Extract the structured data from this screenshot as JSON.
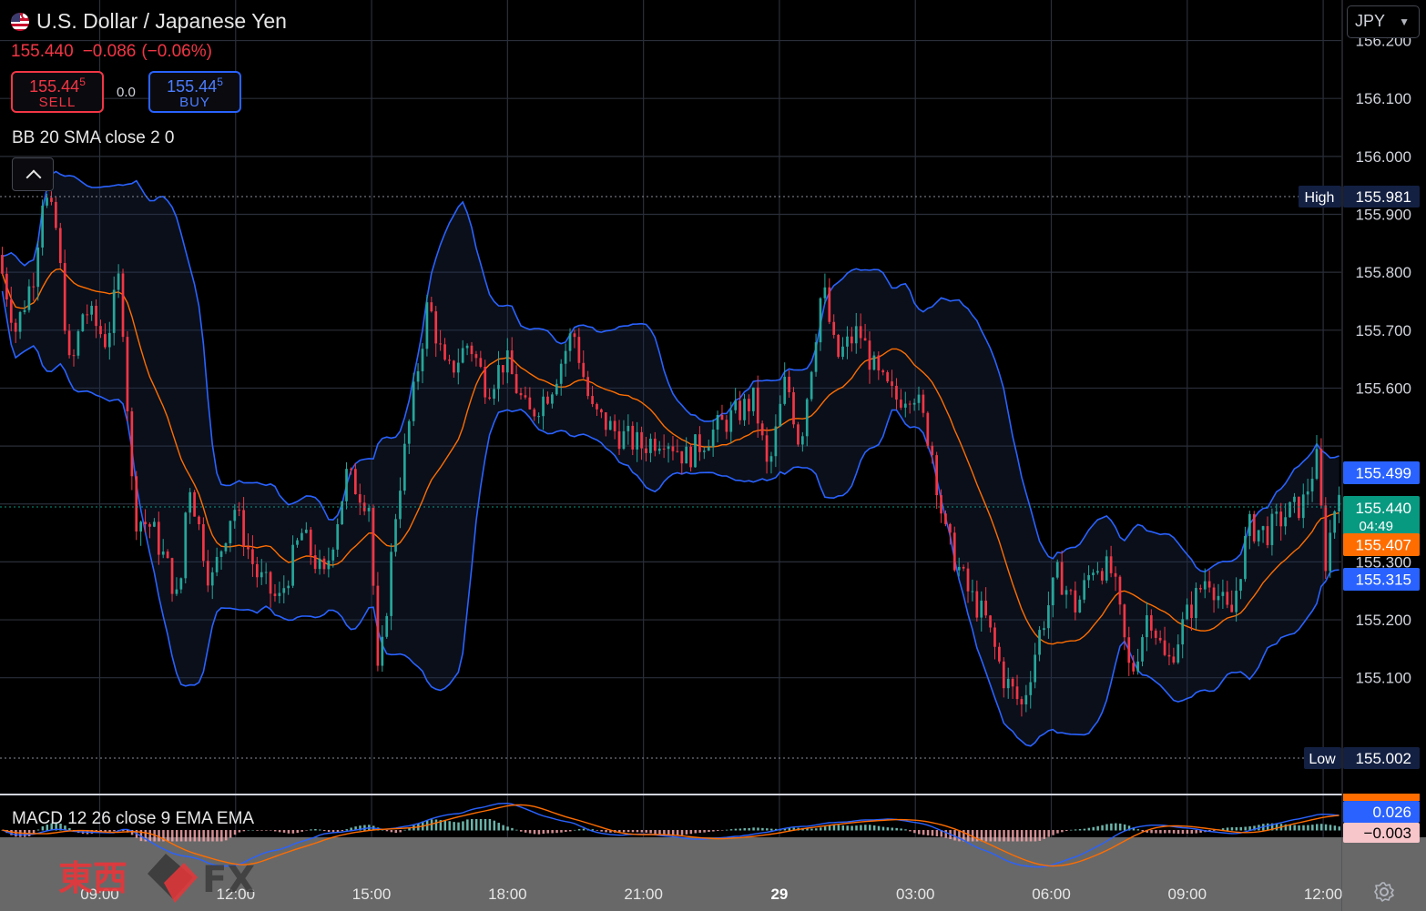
{
  "header": {
    "title": "U.S. Dollar / Japanese Yen",
    "last": "155.440",
    "change": "−0.086",
    "change_pct": "(−0.06%)",
    "sell": {
      "price_main": "155.44",
      "price_sup": "5",
      "label": "SELL"
    },
    "buy": {
      "price_main": "155.44",
      "price_sup": "5",
      "label": "BUY"
    },
    "spread": "0.0",
    "indicator_label": "BB 20 SMA close 2 0",
    "macd_label": "MACD 12 26 close 9 EMA EMA",
    "currency": "JPY"
  },
  "colors": {
    "up": "#26a69a",
    "down": "#f23645",
    "bb": "#2962ff",
    "basis": "#ff6d00",
    "grid": "#2a2e39",
    "text": "#d1d4dc",
    "bg": "#000000",
    "last": "#089981"
  },
  "icons": [
    "us-flag-icon",
    "chevron-down-icon",
    "chevron-up-icon",
    "gear-icon"
  ],
  "chart_data": {
    "type": "candlestick",
    "price_axis": {
      "min": 154.9,
      "max": 156.27,
      "ticks": [
        156.2,
        156.1,
        156.0,
        155.9,
        155.8,
        155.7,
        155.6,
        155.5,
        155.4,
        155.3,
        155.2,
        155.1
      ],
      "tick_labels": [
        "156.200",
        "156.100",
        "156.000",
        "155.900",
        "155.800",
        "155.700",
        "155.600",
        "",
        "",
        "155.300",
        "155.200",
        "155.100"
      ]
    },
    "time_axis": {
      "labels": [
        "09:00",
        "12:00",
        "15:00",
        "18:00",
        "21:00",
        "29",
        "03:00",
        "06:00",
        "09:00",
        "12:00"
      ],
      "label_hours": [
        0,
        3,
        6,
        9,
        12,
        15,
        18,
        21,
        24,
        27
      ],
      "start_hour": -2.2,
      "end_hour": 27.4
    },
    "markers": {
      "high": {
        "label": "High",
        "value": "155.981"
      },
      "low": {
        "label": "Low",
        "value": "155.002"
      },
      "bb_upper": {
        "value": "155.499"
      },
      "last": {
        "value": "155.440",
        "countdown": "04:49"
      },
      "basis": {
        "value": "155.407"
      },
      "bb_lower": {
        "value": "155.315"
      }
    },
    "close_path": [
      [
        -2.2,
        155.83
      ],
      [
        -1.8,
        155.7
      ],
      [
        -1.4,
        155.8
      ],
      [
        -1.2,
        155.94
      ],
      [
        -0.9,
        155.87
      ],
      [
        -0.6,
        155.62
      ],
      [
        -0.3,
        155.74
      ],
      [
        0.2,
        155.68
      ],
      [
        0.5,
        155.8
      ],
      [
        0.8,
        155.38
      ],
      [
        1.2,
        155.36
      ],
      [
        1.6,
        155.28
      ],
      [
        1.8,
        155.22
      ],
      [
        2.0,
        155.45
      ],
      [
        2.5,
        155.26
      ],
      [
        3.0,
        155.4
      ],
      [
        3.5,
        155.28
      ],
      [
        4.0,
        155.23
      ],
      [
        4.5,
        155.35
      ],
      [
        5.0,
        155.27
      ],
      [
        5.5,
        155.45
      ],
      [
        6.0,
        155.4
      ],
      [
        6.2,
        155.08
      ],
      [
        6.6,
        155.4
      ],
      [
        7.0,
        155.6
      ],
      [
        7.3,
        155.75
      ],
      [
        7.7,
        155.62
      ],
      [
        8.2,
        155.68
      ],
      [
        8.6,
        155.6
      ],
      [
        9.0,
        155.65
      ],
      [
        9.5,
        155.55
      ],
      [
        10.0,
        155.6
      ],
      [
        10.5,
        155.7
      ],
      [
        10.9,
        155.56
      ],
      [
        11.5,
        155.52
      ],
      [
        12.0,
        155.5
      ],
      [
        12.5,
        155.52
      ],
      [
        13.0,
        155.48
      ],
      [
        13.5,
        155.52
      ],
      [
        14.0,
        155.55
      ],
      [
        14.5,
        155.58
      ],
      [
        14.8,
        155.45
      ],
      [
        15.2,
        155.62
      ],
      [
        15.5,
        155.5
      ],
      [
        16.0,
        155.78
      ],
      [
        16.3,
        155.65
      ],
      [
        16.8,
        155.7
      ],
      [
        17.2,
        155.62
      ],
      [
        17.6,
        155.58
      ],
      [
        18.0,
        155.6
      ],
      [
        18.4,
        155.5
      ],
      [
        18.7,
        155.35
      ],
      [
        19.2,
        155.25
      ],
      [
        19.6,
        155.2
      ],
      [
        20.0,
        155.1
      ],
      [
        20.4,
        155.05
      ],
      [
        20.8,
        155.18
      ],
      [
        21.2,
        155.28
      ],
      [
        21.6,
        155.22
      ],
      [
        22.0,
        155.3
      ],
      [
        22.4,
        155.28
      ],
      [
        22.8,
        155.1
      ],
      [
        23.2,
        155.22
      ],
      [
        23.6,
        155.12
      ],
      [
        24.0,
        155.2
      ],
      [
        24.5,
        155.28
      ],
      [
        25.0,
        155.2
      ],
      [
        25.4,
        155.36
      ],
      [
        25.8,
        155.35
      ],
      [
        26.2,
        155.38
      ],
      [
        26.6,
        155.4
      ],
      [
        26.9,
        155.48
      ],
      [
        27.1,
        155.3
      ],
      [
        27.4,
        155.44
      ]
    ],
    "macd": {
      "macd_value": "0.026",
      "signal_value": "−0.003"
    }
  }
}
